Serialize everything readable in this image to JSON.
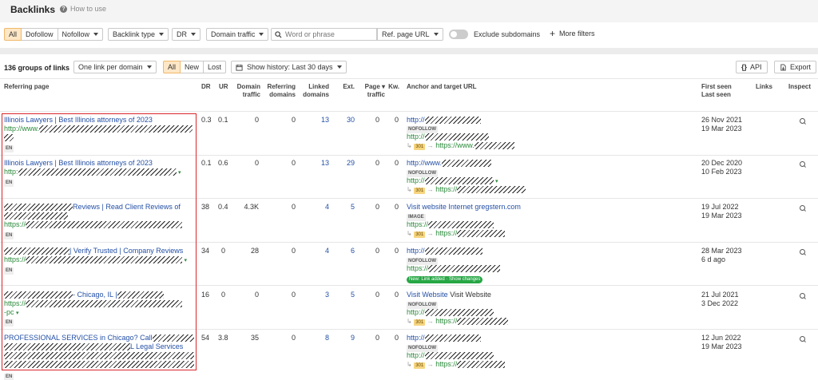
{
  "header": {
    "title": "Backlinks",
    "howto": "How to use"
  },
  "filters": {
    "type_tabs": [
      "All",
      "Dofollow"
    ],
    "nofollow": "Nofollow",
    "backlink_type": "Backlink type",
    "dr": "DR",
    "domain_traffic": "Domain traffic",
    "search_placeholder": "Word or phrase",
    "ref_page_url": "Ref. page URL",
    "exclude_subdomains": "Exclude subdomains",
    "more_filters": "More filters"
  },
  "toolbar": {
    "groups": "136 groups of links",
    "per_domain": "One link per domain",
    "status_tabs": [
      "All",
      "New",
      "Lost"
    ],
    "history": "Show history: Last 30 days",
    "api": "API",
    "export": "Export"
  },
  "columns": {
    "referring_page": "Referring page",
    "dr": "DR",
    "ur": "UR",
    "domain_traffic_1": "Domain",
    "domain_traffic_2": "traffic",
    "ref_domains_1": "Referring",
    "ref_domains_2": "domains",
    "linked_1": "Linked",
    "linked_2": "domains",
    "ext": "Ext.",
    "page_traffic_1": "Page ▾",
    "page_traffic_2": "traffic",
    "kw": "Kw.",
    "anchor": "Anchor and target URL",
    "first_seen": "First seen",
    "last_seen": "Last seen",
    "links": "Links",
    "inspect": "Inspect"
  },
  "rows": [
    {
      "title_a": "Illinois Lawyers | Best Illinois attorneys of 2023",
      "title_b": "",
      "url": "http://www.",
      "lang": "EN",
      "dr": "0.3",
      "ur": "0.1",
      "traffic": "0",
      "refdomains": "0",
      "linked": "13",
      "ext": "30",
      "page_traffic": "0",
      "kw": "0",
      "anchor": "http://",
      "tag": "NOFOLLOW",
      "target": "http://",
      "redirect": "301",
      "redirect_url": "https://www.",
      "first_seen": "26 Nov 2021",
      "last_seen": "19 Mar 2023"
    },
    {
      "title_a": "Illinois Lawyers | Best Illinois attorneys of 2023",
      "title_b": "",
      "url": "http:",
      "lang": "EN",
      "dr": "0.1",
      "ur": "0.6",
      "traffic": "0",
      "refdomains": "0",
      "linked": "13",
      "ext": "29",
      "page_traffic": "0",
      "kw": "0",
      "anchor": "http://www.",
      "tag": "NOFOLLOW",
      "target": "http://",
      "redirect": "301",
      "redirect_url": "https://",
      "first_seen": "20 Dec 2020",
      "last_seen": "10 Feb 2023"
    },
    {
      "title_a": "Reviews | Read Client Reviews of",
      "title_b": "",
      "url": "https://",
      "lang": "EN",
      "dr": "38",
      "ur": "0.4",
      "traffic": "4.3K",
      "refdomains": "0",
      "linked": "4",
      "ext": "5",
      "page_traffic": "0",
      "kw": "0",
      "anchor": "Visit website Internet gregstern.com",
      "tag": "IMAGE",
      "target": "https://",
      "redirect": "301",
      "redirect_url": "https://",
      "first_seen": "19 Jul 2022",
      "last_seen": "19 Mar 2023"
    },
    {
      "title_a": "| Verify Trusted | Company Reviews",
      "title_b": "",
      "url": "https://",
      "lang": "EN",
      "dr": "34",
      "ur": "0",
      "traffic": "28",
      "refdomains": "0",
      "linked": "4",
      "ext": "6",
      "page_traffic": "0",
      "kw": "0",
      "anchor": "http://",
      "tag": "NOFOLLOW",
      "target": "https://",
      "new_badge": "New: Link added · Show changes",
      "first_seen": "28 Mar 2023",
      "last_seen": "6 d ago"
    },
    {
      "title_a": "- Chicago, IL |",
      "title_b": "",
      "url": "https://",
      "url_extra": "-pc",
      "lang": "EN",
      "dr": "16",
      "ur": "0",
      "traffic": "0",
      "refdomains": "0",
      "linked": "3",
      "ext": "5",
      "page_traffic": "0",
      "kw": "0",
      "anchor": "Visit Website",
      "anchor_plain": "Visit Website",
      "tag": "NOFOLLOW",
      "target": "http://",
      "redirect": "301",
      "redirect_url": "https://",
      "first_seen": "21 Jul 2021",
      "last_seen": "3 Dec 2022"
    },
    {
      "title_a": "PROFESSIONAL SERVICES in Chicago? Call",
      "title_b": "L Legal Services",
      "url": "",
      "lang": "EN",
      "dr": "54",
      "ur": "3.8",
      "traffic": "35",
      "refdomains": "0",
      "linked": "8",
      "ext": "9",
      "page_traffic": "0",
      "kw": "0",
      "anchor": "http://",
      "tag": "NOFOLLOW",
      "target": "http://",
      "redirect": "301",
      "redirect_url": "https://",
      "first_seen": "12 Jun 2022",
      "last_seen": "19 Mar 2023"
    }
  ]
}
